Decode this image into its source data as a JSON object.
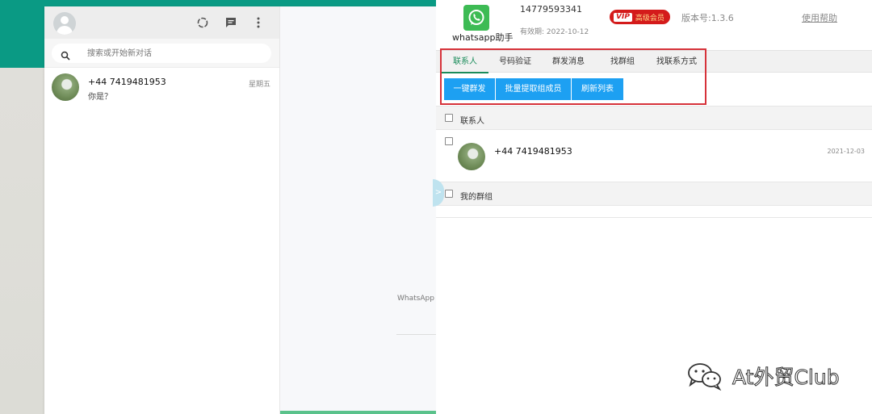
{
  "whatsapp": {
    "search": {
      "placeholder": "搜索或开始新对话"
    },
    "chat": {
      "name": "+44 7419481953",
      "last_message": "你是？",
      "time": "星期五"
    },
    "right_pane": {
      "text": "WhatsApp"
    },
    "icons": {
      "status": "status-icon",
      "new_chat": "new-chat-icon",
      "menu": "menu-icon",
      "search": "search-icon"
    }
  },
  "helper": {
    "app_name": "whatsapp助手",
    "phone": "14779593341",
    "valid_until": "有效期: 2022-10-12",
    "vip": {
      "tag": "VIP",
      "label": "高级会员"
    },
    "version": "版本号:1.3.6",
    "help": "使用帮助",
    "tabs": [
      {
        "label": "联系人",
        "active": true
      },
      {
        "label": "号码验证",
        "active": false
      },
      {
        "label": "群发消息",
        "active": false
      },
      {
        "label": "找群组",
        "active": false
      },
      {
        "label": "找联系方式",
        "active": false
      }
    ],
    "buttons": [
      "一键群发",
      "批量提取组成员",
      "刷新列表"
    ],
    "sections": {
      "contacts": "联系人",
      "groups": "我的群组"
    },
    "contact": {
      "name": "+44 7419481953",
      "date": "2021-12-03"
    },
    "side_toggle": ">",
    "colors": {
      "accent": "#1da0f2",
      "highlight": "#d6323a",
      "vip": "#d41b1b",
      "active_tab": "#1a8c5a"
    }
  },
  "watermark": {
    "text": "At外贸Club"
  }
}
